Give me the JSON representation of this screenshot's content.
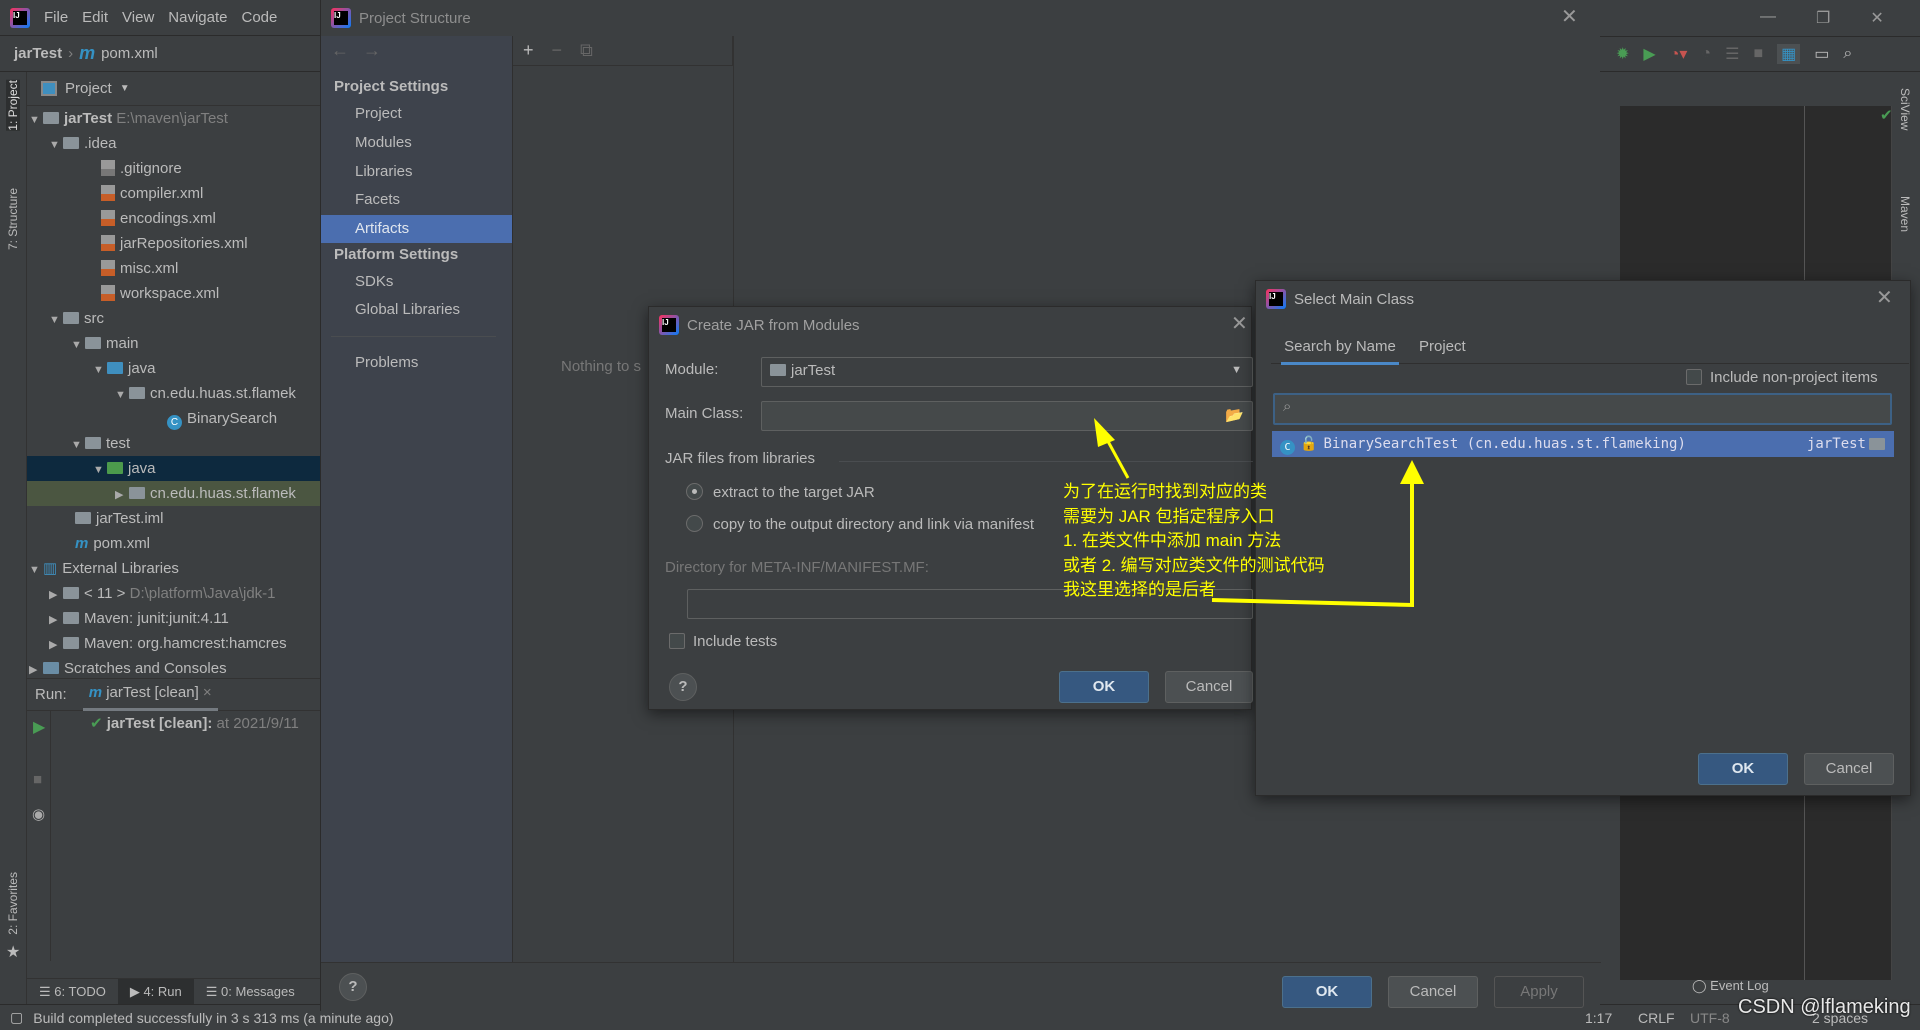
{
  "menu": {
    "items": [
      "File",
      "Edit",
      "View",
      "Navigate",
      "Code"
    ]
  },
  "breadcrumb": {
    "project": "jarTest",
    "file": "pom.xml"
  },
  "left_strip": {
    "project_tab": "1: Project",
    "structure_tab": "7: Structure",
    "favorites_tab": "2: Favorites"
  },
  "project_panel": {
    "view_label": "Project",
    "tree": [
      {
        "label": "jarTest",
        "extra": "E:\\maven\\jarTest"
      },
      {
        "label": ".idea"
      },
      {
        "label": ".gitignore"
      },
      {
        "label": "compiler.xml"
      },
      {
        "label": "encodings.xml"
      },
      {
        "label": "jarRepositories.xml"
      },
      {
        "label": "misc.xml"
      },
      {
        "label": "workspace.xml"
      },
      {
        "label": "src"
      },
      {
        "label": "main"
      },
      {
        "label": "java"
      },
      {
        "label": "cn.edu.huas.st.flamek"
      },
      {
        "label": "BinarySearch"
      },
      {
        "label": "test"
      },
      {
        "label": "java"
      },
      {
        "label": "cn.edu.huas.st.flamek"
      },
      {
        "label": "jarTest.iml"
      },
      {
        "label": "pom.xml"
      },
      {
        "label": "External Libraries"
      },
      {
        "label": "< 11 >",
        "extra": "D:\\platform\\Java\\jdk-1"
      },
      {
        "label": "Maven: junit:junit:4.11"
      },
      {
        "label": "Maven: org.hamcrest:hamcres"
      },
      {
        "label": "Scratches and Consoles"
      }
    ]
  },
  "run_panel": {
    "label": "Run:",
    "tab": "jarTest [clean]",
    "entry": "jarTest [clean]:",
    "entry_time": "at 2021/9/11"
  },
  "bottom_tabs": [
    "6: TODO",
    "4: Run",
    "0: Messages"
  ],
  "status_bar": {
    "message": "Build completed successfully in 3 s 313 ms (a minute ago)",
    "position": "1:17",
    "line_sep": "CRLF",
    "encoding": "UTF-8",
    "indent": "2 spaces",
    "event_log": "Event Log"
  },
  "right_strip": {
    "sciview": "SciView",
    "maven": "Maven"
  },
  "project_structure": {
    "title": "Project Structure",
    "project_settings_header": "Project Settings",
    "project_settings": [
      "Project",
      "Modules",
      "Libraries",
      "Facets",
      "Artifacts"
    ],
    "selected": "Artifacts",
    "platform_settings_header": "Platform Settings",
    "platform_settings": [
      "SDKs",
      "Global Libraries"
    ],
    "problems": "Problems",
    "empty_text": "Nothing to s",
    "ok": "OK",
    "cancel": "Cancel",
    "apply": "Apply"
  },
  "create_jar": {
    "title": "Create JAR from Modules",
    "module_label": "Module:",
    "module_value": "jarTest",
    "main_class_label": "Main Class:",
    "main_class_value": "",
    "jar_files_label": "JAR files from libraries",
    "option_extract": "extract to the target JAR",
    "option_copy": "copy to the output directory and link via manifest",
    "selected_option": "extract",
    "manifest_dir_label": "Directory for META-INF/MANIFEST.MF:",
    "include_tests": "Include tests",
    "ok": "OK",
    "cancel": "Cancel"
  },
  "select_main_class": {
    "title": "Select Main Class",
    "tabs": [
      "Search by Name",
      "Project"
    ],
    "active_tab": "Search by Name",
    "include_non_project": "Include non-project items",
    "search_value": "",
    "results": [
      {
        "name": "BinarySearchTest (cn.edu.huas.st.flameking)",
        "module": "jarTest"
      }
    ],
    "ok": "OK",
    "cancel": "Cancel"
  },
  "annotation": {
    "lines": [
      "为了在运行时找到对应的类",
      "需要为 JAR 包指定程序入口",
      "1. 在类文件中添加 main 方法",
      "或者 2. 编写对应类文件的测试代码",
      "我这里选择的是后者"
    ],
    "color": "#ffff00"
  },
  "watermark": "CSDN @lflameking",
  "colors": {
    "accent": "#4b6eaf",
    "ok_button": "#365880",
    "background": "#3c3f41",
    "editor": "#2b2b2b"
  }
}
